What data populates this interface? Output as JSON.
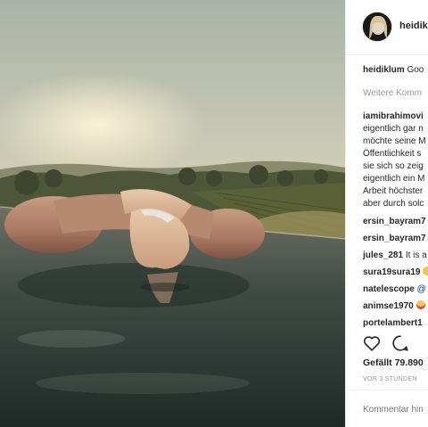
{
  "post": {
    "username": "heidik",
    "likes": "Gefällt 79.890",
    "time": "VOR 3 STUNDEN",
    "comment_placeholder": "Kommentar hin"
  },
  "caption": {
    "user": "heidiklum",
    "text": "Goo"
  },
  "more_comments": "Weitere Komm",
  "long_comment": {
    "user": "iamibrahimovi",
    "lines": [
      "eigentlich gar n",
      "möchte seine M",
      "Öffentlichkeit s",
      "sie sich so zeig",
      "eigentlich ein M",
      "Arbeit höchster",
      "aber durch solc"
    ]
  },
  "comments": [
    {
      "user": "ersin_bayram7",
      "text": ""
    },
    {
      "user": "ersin_bayram7",
      "text": ""
    },
    {
      "user": "jules_281",
      "text": "It is a"
    },
    {
      "user": "sura19sura19",
      "text": ""
    },
    {
      "user": "natelescope",
      "text": "@"
    },
    {
      "user": "animse1970",
      "text": ""
    },
    {
      "user": "portelambert1",
      "text": ""
    }
  ],
  "icons": {
    "like": "heart-outline-icon",
    "comment": "speech-bubble-icon"
  }
}
